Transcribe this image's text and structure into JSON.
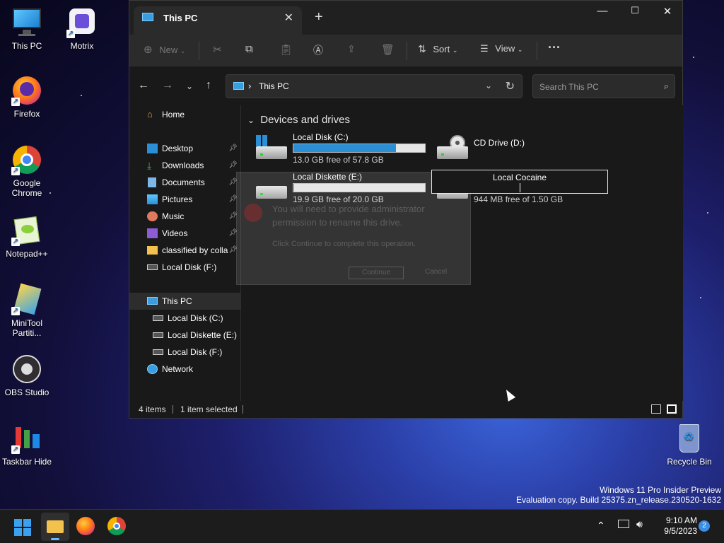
{
  "desktop": {
    "icons": [
      {
        "label": "This PC"
      },
      {
        "label": "Motrix"
      },
      {
        "label": "Firefox"
      },
      {
        "label": "Google Chrome"
      },
      {
        "label": "Notepad++"
      },
      {
        "label": "MiniTool Partiti..."
      },
      {
        "label": "OBS Studio"
      },
      {
        "label": "Taskbar Hide"
      },
      {
        "label": "Recycle Bin"
      }
    ],
    "watermark_line1": "Windows 11 Pro Insider Preview",
    "watermark_line2": "Evaluation copy. Build 25375.zn_release.230520-1632"
  },
  "window": {
    "tab_title": "This PC",
    "toolbar": {
      "new_label": "New",
      "sort_label": "Sort",
      "view_label": "View"
    },
    "address": {
      "path": "This PC",
      "search_placeholder": "Search This PC"
    },
    "nav": {
      "home": "Home",
      "quick": [
        "Desktop",
        "Downloads",
        "Documents",
        "Pictures",
        "Music",
        "Videos",
        "classified by colla",
        "Local Disk (F:)"
      ],
      "this_pc": "This PC",
      "drives": [
        "Local Disk (C:)",
        "Local Diskette (E:)",
        "Local Disk (F:)"
      ],
      "network": "Network"
    },
    "content": {
      "group_title": "Devices and drives",
      "drives": [
        {
          "name": "Local Disk (C:)",
          "free": "13.0 GB free of 57.8 GB",
          "used_fraction": 0.78
        },
        {
          "name": "CD Drive (D:)"
        },
        {
          "name": "Local Diskette (E:)",
          "free": "19.9 GB free of 20.0 GB",
          "used_fraction": 0.005
        },
        {
          "name": "Local Cocaine",
          "free": "944 MB free of 1.50 GB",
          "used_fraction": 0.39
        }
      ]
    },
    "dialog_ghost": {
      "line1": "You will need to provide administrator",
      "line2": "permission to rename this drive.",
      "line3": "Click Continue to complete this operation.",
      "continue": "Continue",
      "cancel": "Cancel"
    },
    "status": {
      "items": "4 items",
      "selected": "1 item selected"
    }
  },
  "taskbar": {
    "time": "9:10 AM",
    "date": "9/5/2023",
    "notification_count": "2"
  }
}
